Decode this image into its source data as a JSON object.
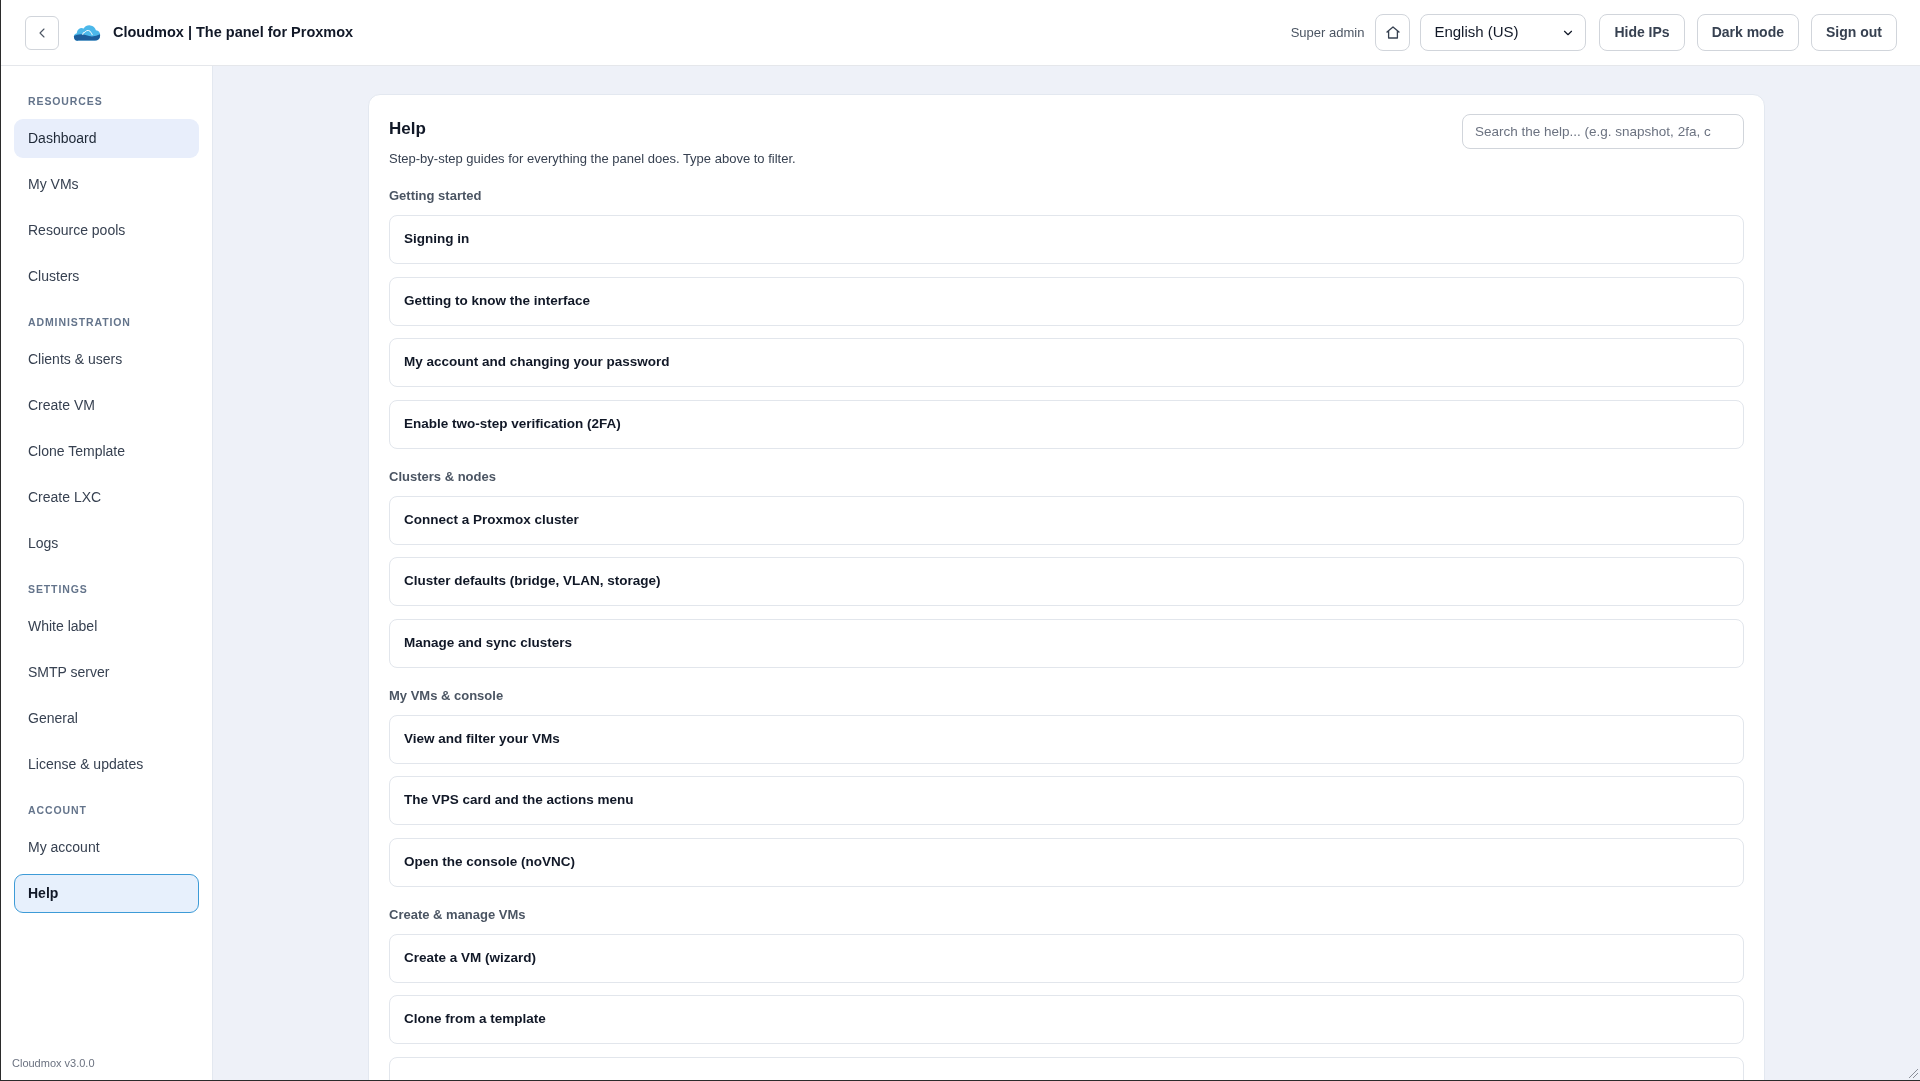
{
  "topbar": {
    "title": "Cloudmox | The panel for Proxmox",
    "role": "Super admin",
    "language": "English (US)",
    "buttons": [
      "Hide IPs",
      "Dark mode",
      "Sign out"
    ]
  },
  "sidebar": {
    "sections": [
      {
        "heading": "RESOURCES",
        "items": [
          {
            "label": "Dashboard",
            "selected": false,
            "highlighted": true
          },
          {
            "label": "My VMs",
            "selected": false,
            "highlighted": false
          },
          {
            "label": "Resource pools",
            "selected": false,
            "highlighted": false
          },
          {
            "label": "Clusters",
            "selected": false,
            "highlighted": false
          }
        ]
      },
      {
        "heading": "ADMINISTRATION",
        "items": [
          {
            "label": "Clients & users",
            "selected": false,
            "highlighted": false
          },
          {
            "label": "Create VM",
            "selected": false,
            "highlighted": false
          },
          {
            "label": "Clone Template",
            "selected": false,
            "highlighted": false
          },
          {
            "label": "Create LXC",
            "selected": false,
            "highlighted": false
          },
          {
            "label": "Logs",
            "selected": false,
            "highlighted": false
          }
        ]
      },
      {
        "heading": "SETTINGS",
        "items": [
          {
            "label": "White label",
            "selected": false,
            "highlighted": false
          },
          {
            "label": "SMTP server",
            "selected": false,
            "highlighted": false
          },
          {
            "label": "General",
            "selected": false,
            "highlighted": false
          },
          {
            "label": "License & updates",
            "selected": false,
            "highlighted": false
          }
        ]
      },
      {
        "heading": "ACCOUNT",
        "items": [
          {
            "label": "My account",
            "selected": false,
            "highlighted": false
          },
          {
            "label": "Help",
            "selected": true,
            "highlighted": false
          }
        ]
      }
    ],
    "version": "Cloudmox v3.0.0"
  },
  "help": {
    "title": "Help",
    "subtitle": "Step-by-step guides for everything the panel does. Type above to filter.",
    "search": {
      "placeholder": "Search the help... (e.g. snapshot, 2fa, c"
    },
    "sections": [
      {
        "heading": "Getting started",
        "articles": [
          "Signing in",
          "Getting to know the interface",
          "My account and changing your password",
          "Enable two-step verification (2FA)"
        ]
      },
      {
        "heading": "Clusters & nodes",
        "articles": [
          "Connect a Proxmox cluster",
          "Cluster defaults (bridge, VLAN, storage)",
          "Manage and sync clusters"
        ]
      },
      {
        "heading": "My VMs & console",
        "articles": [
          "View and filter your VMs",
          "The VPS card and the actions menu",
          "Open the console (noVNC)"
        ]
      },
      {
        "heading": "Create & manage VMs",
        "articles": [
          "Create a VM (wizard)",
          "Clone from a template"
        ]
      }
    ]
  }
}
